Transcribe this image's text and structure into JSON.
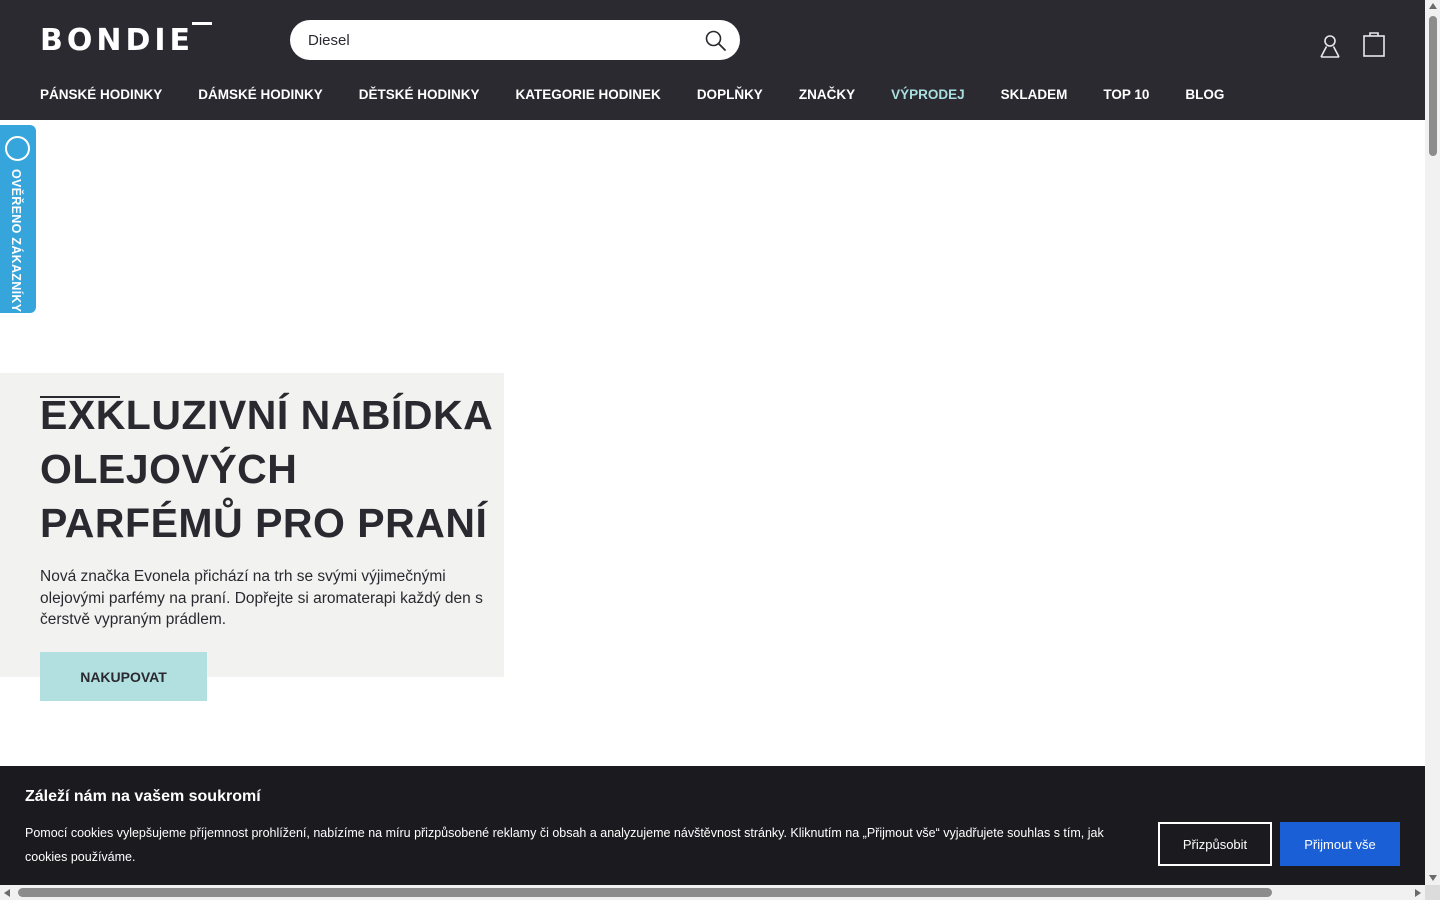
{
  "header": {
    "logo_text": "BONDIE",
    "search": {
      "value": "Diesel",
      "icon": "search-icon"
    },
    "icons": {
      "account": "user-icon",
      "cart": "shopping-bag-icon"
    },
    "nav": [
      "PÁNSKÉ HODINKY",
      "DÁMSKÉ HODINKY",
      "DĚTSKÉ HODINKY",
      "KATEGORIE HODINEK",
      "DOPLŇKY",
      "ZNAČKY",
      "VÝPRODEJ",
      "SKLADEM",
      "TOP 10",
      "BLOG"
    ]
  },
  "verified_badge": {
    "label": "OVĚŘENO ZÁKAZNÍKY"
  },
  "hero": {
    "title": "EXKLUZIVNÍ NABÍDKA OLEJOVÝCH PARFÉMŮ PRO PRANÍ",
    "text": "Nová značka Evonela přichází na trh se svými výjimečnými olejovými parfémy na praní. Dopřejte si aromaterapi každý den s čerstvě vypraným prádlem.",
    "button_label": "NAKUPOVAT"
  },
  "cookie": {
    "title": "Záleží nám na vašem soukromí",
    "text": "Pomocí cookies vylepšujeme příjemnost prohlížení, nabízíme na míru přizpůsobené reklamy či obsah a analyzujeme návštěvnost stránky. Kliknutím na „Přijmout vše“ vyjadřujete souhlas s tím, jak cookies používáme.",
    "customize_label": "Přizpůsobit",
    "accept_label": "Přijmout vše"
  },
  "colors": {
    "header_bg": "#2b2a31",
    "sale_link": "#a9dede",
    "cta_bg": "#b2e0e0",
    "badge_bg": "#35a5dc",
    "cookie_bg": "#1b1a1f",
    "accept_bg": "#1a5fd6"
  }
}
